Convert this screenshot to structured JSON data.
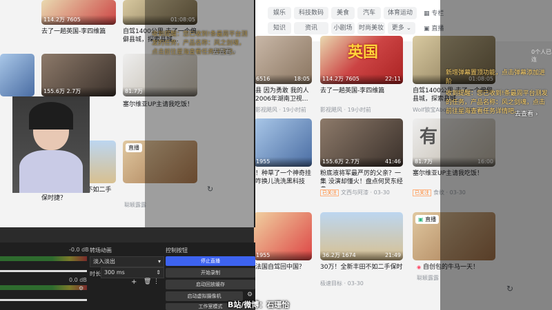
{
  "nav": {
    "left_tabs": [
      "娱乐",
      "科技数码",
      "美食",
      "汽车",
      "体育运动"
    ],
    "left_tabs2": [
      "知识",
      "资讯",
      "小剧场",
      "时尚美妆",
      "更多"
    ],
    "side_a": [
      "专栏",
      "活动",
      "社区中心"
    ],
    "side_b": [
      "直播",
      "课堂",
      "新歌热榜"
    ]
  },
  "cards": [
    {
      "stat1": "6516",
      "stat2": "",
      "dur": "18:05",
      "title": "县 因为勇敢 我的人 2006年湖南卫视...",
      "author": "影视飓风",
      "date": "19小时前"
    },
    {
      "stat1": "114.2万",
      "stat2": "7605",
      "dur": "22:11",
      "title": "去了一趟英国-李四维篇",
      "author": "影视飓风",
      "date": "19小时前"
    },
    {
      "stat1": "",
      "stat2": "",
      "dur": "01:08:05",
      "title": "自驾1400公里 去了一个偏僻县城，探索县城...",
      "author": "Wolf狼宝About",
      "date": "03-30"
    },
    {
      "stat1": "1955",
      "stat2": "",
      "dur": "",
      "title": "！种草了一个神奇挂 咋换儿洗洗黑科技",
      "author": "",
      "date": "03-30"
    },
    {
      "stat1": "155.6万",
      "stat2": "2.7万",
      "dur": "41:46",
      "title": "粉底液将军最严厉的父亲？一集 没演却懂火！盘点何炅东经典...",
      "author": "文西与阿漆",
      "date": "03-30"
    },
    {
      "stat1": "81.7万",
      "stat2": "",
      "dur": "16:00",
      "title": "塞尔维亚UP主请我吃饭！",
      "author": "食纹",
      "date": "03-30"
    },
    {
      "stat1": "1955",
      "stat2": "",
      "dur": "",
      "title": "法国自驾回中国？",
      "author": "",
      "date": "03-30"
    },
    {
      "stat1": "36.2万",
      "stat2": "1674",
      "dur": "21:49",
      "title": "30万！全新丰田不如二手保时捷？",
      "author": "极速目标",
      "date": "03-30"
    },
    {
      "stat1": "",
      "stat2": "",
      "dur": "",
      "title": "自创包的牛马一天！",
      "author": "聪颖露露",
      "date": ""
    }
  ],
  "live": {
    "tag": "直播",
    "badge": "已关注"
  },
  "announce": {
    "line1": "新增弹幕置顶功能，点击弹幕添加进阶",
    "line2": "收到提醒：您已收到!条最周平台测发的任务，产品名称：风之剑魂，点击前往星海查看任务详情吧。",
    "link": "去查看 ›"
  },
  "obs": {
    "transitions_title": "转场动画",
    "transition_value": "淡入淡出",
    "duration_label": "时长",
    "duration_value": "300 ms",
    "controls_title": "控制按钮",
    "buttons": [
      "停止直播",
      "开始录制",
      "启动回放缓存",
      "启动虚拟摄像机",
      "工作室模式"
    ],
    "meter_values": [
      "-0.0 dB",
      "0.0 dB"
    ]
  },
  "caption": "B站/微博：石珊怡",
  "right_text": "0个人已连",
  "colors": {
    "accent": "#3d63f0",
    "live_red": "#ff4060"
  }
}
